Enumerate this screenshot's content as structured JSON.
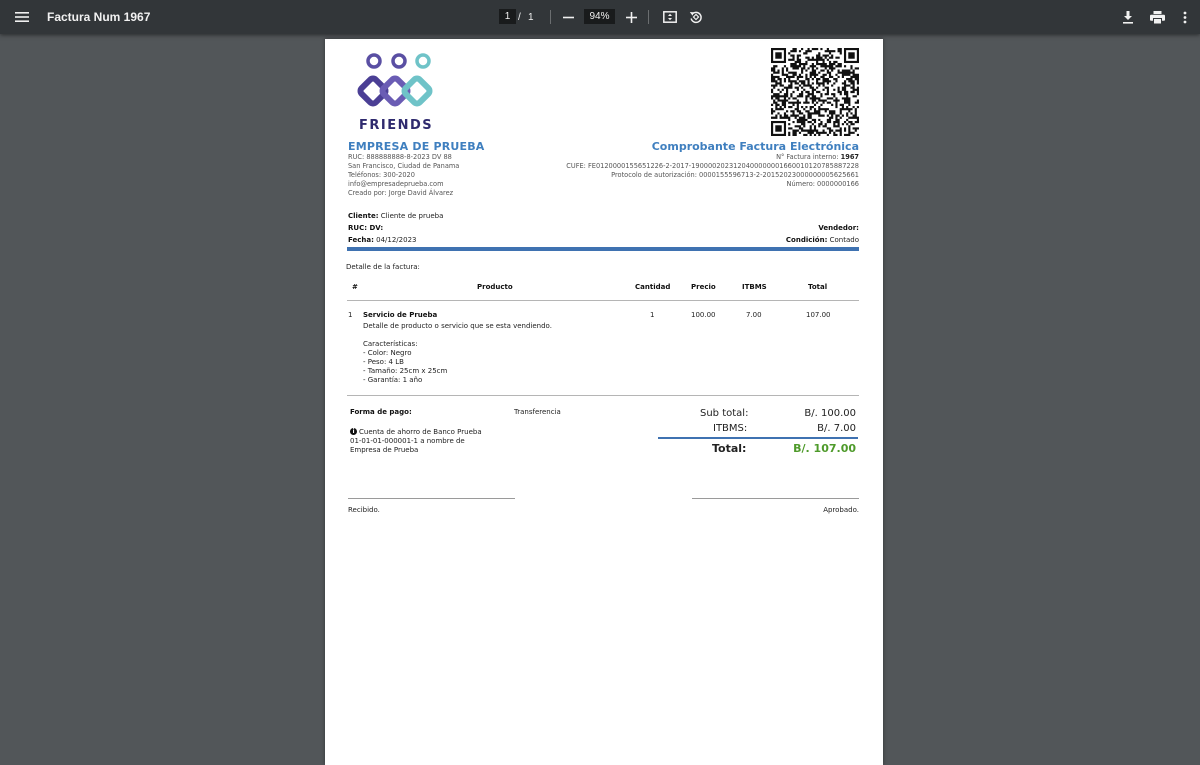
{
  "toolbar": {
    "title": "Factura Num 1967",
    "current_page": "1",
    "page_separator": "/",
    "total_pages": "1",
    "zoom": "94%",
    "icons": [
      "menu-icon",
      "zoom-out-icon",
      "zoom-in-icon",
      "fit-page-icon",
      "rotate-icon",
      "download-icon",
      "print-icon",
      "more-icon"
    ]
  },
  "invoice": {
    "logo_text": "FRIENDS",
    "company": {
      "name": "EMPRESA DE PRUEBA",
      "lines": [
        "RUC: 888888888-8-2023 DV 88",
        "San Francisco, Ciudad de Panama",
        "Teléfonos: 300-2020",
        "info@empresadeprueba.com",
        "Creado por: Jorge David Álvarez"
      ]
    },
    "doc": {
      "title": "Comprobante Factura Electrónica",
      "internal_label": "N° Factura interno: ",
      "internal_number": "1967",
      "cufe": "CUFE: FE0120000155651226-2-2017-1900002023120400000001660010120785887228",
      "protocol": "Protocolo de autorización: 0000155596713-2-20152023000000005625661",
      "number": "Número: 0000000166"
    },
    "client": {
      "client_label": "Cliente:",
      "client_value": " Cliente de prueba",
      "ruc_label": "RUC: DV:",
      "date_label": "Fecha:",
      "date_value": " 04/12/2023",
      "seller_label": "Vendedor:",
      "condition_label": "Condición:",
      "condition_value": " Contado"
    },
    "detail_title": "Detalle de la factura:",
    "table": {
      "headers": {
        "num": "#",
        "product": "Producto",
        "qty": "Cantidad",
        "price": "Precio",
        "tax": "ITBMS",
        "total": "Total"
      },
      "rows": [
        {
          "num": "1",
          "name": "Servicio de Prueba",
          "description": "Detalle de producto o servicio que se esta vendiendo.",
          "features_title": "Características:",
          "features": [
            "- Color: Negro",
            "- Peso: 4 LB",
            "- Tamaño: 25cm x 25cm",
            "- Garantía: 1 año"
          ],
          "qty": "1",
          "price": "100.00",
          "tax": "7.00",
          "total": "107.00"
        }
      ]
    },
    "payment": {
      "label": "Forma de pago:",
      "method": "Transferencia",
      "account_lines": [
        "Cuenta de ahorro de Banco Prueba",
        "01-01-01-000001-1 a nombre de",
        "Empresa de Prueba"
      ]
    },
    "totals": {
      "subtotal_label": "Sub total:",
      "subtotal_value": "B/. 100.00",
      "tax_label": "ITBMS:",
      "tax_value": "B/. 7.00",
      "total_label": "Total:",
      "total_value": "B/. 107.00"
    },
    "signatures": {
      "received": "Recibido.",
      "approved": "Aprobado."
    },
    "colors": {
      "accent_blue": "#3f7fbf",
      "bar_blue": "#3f72b1",
      "total_green": "#4e9a2a"
    }
  }
}
